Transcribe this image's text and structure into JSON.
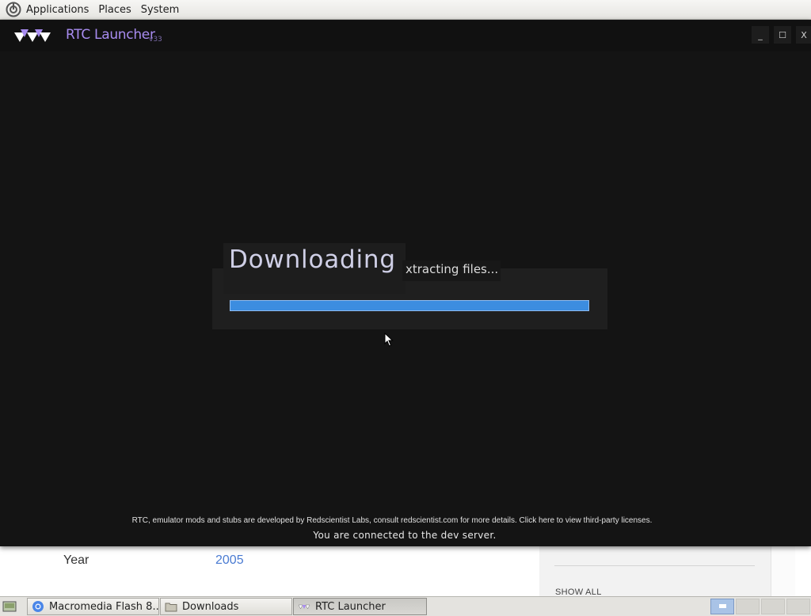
{
  "top_panel": {
    "menus": [
      "Applications",
      "Places",
      "System"
    ]
  },
  "launcher": {
    "title": "RTC Launcher",
    "version": "v33",
    "window_buttons": {
      "minimize": "_",
      "maximize": "☐",
      "close": "X"
    },
    "heading": "Downloading",
    "status": "xtracting files...",
    "progress_fraction": 1.0,
    "footer_credits": "RTC, emulator mods and stubs are developed by Redscientist Labs, consult redscientist.com for more details. Click here to view third-party licenses.",
    "footer_server": "You are connected to the dev server."
  },
  "background_page": {
    "year_label": "Year",
    "year_value": "2005",
    "show_all": "SHOW ALL"
  },
  "taskbar": {
    "items": [
      {
        "label": "Macromedia Flash 8...",
        "icon": "browser-icon"
      },
      {
        "label": "Downloads",
        "icon": "folder-icon"
      },
      {
        "label": "RTC Launcher",
        "icon": "rtc-logo-icon"
      }
    ],
    "active_workspace": 1
  },
  "colors": {
    "launcher_bg": "#141414",
    "accent_purple": "#a88cf0",
    "progress_blue": "#3c8de0",
    "link_blue": "#4a7bd2"
  }
}
